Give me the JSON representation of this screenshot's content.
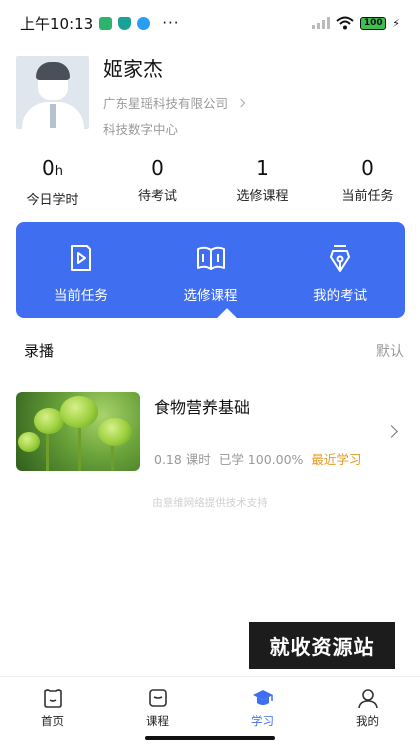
{
  "status_bar": {
    "time": "上午10:13",
    "dots": "···",
    "battery": "100"
  },
  "profile": {
    "name": "姬家杰",
    "company": "广东星瑶科技有限公司",
    "department": "科技数字中心"
  },
  "stats": [
    {
      "value": "0",
      "unit": "h",
      "label": "今日学时"
    },
    {
      "value": "0",
      "unit": "",
      "label": "待考试"
    },
    {
      "value": "1",
      "unit": "",
      "label": "选修课程"
    },
    {
      "value": "0",
      "unit": "",
      "label": "当前任务"
    }
  ],
  "panel": {
    "items": [
      {
        "label": "当前任务",
        "icon": "play-book-icon"
      },
      {
        "label": "选修课程",
        "icon": "open-book-icon"
      },
      {
        "label": "我的考试",
        "icon": "pen-nib-icon"
      }
    ],
    "selected": "选修课程",
    "color": "#3f6ff0"
  },
  "section": {
    "title": "录播",
    "action": "默认"
  },
  "course": {
    "title": "食物营养基础",
    "hours": "0.18 课时",
    "progress": "已学 100.00%",
    "recent": "最近学习"
  },
  "powered_by": "由意维网络提供技术支持",
  "watermark": "就收资源站",
  "tabbar": {
    "tabs": [
      {
        "label": "首页",
        "icon": "home-icon"
      },
      {
        "label": "课程",
        "icon": "course-icon"
      },
      {
        "label": "学习",
        "icon": "graduation-cap-icon"
      },
      {
        "label": "我的",
        "icon": "user-icon"
      }
    ],
    "active": "学习"
  }
}
